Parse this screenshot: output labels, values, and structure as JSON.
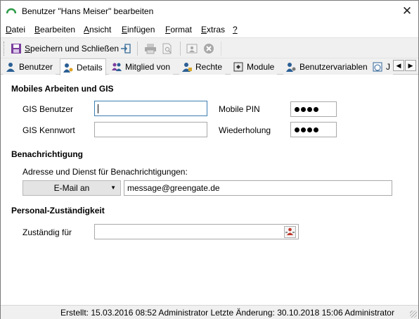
{
  "window": {
    "title": "Benutzer \"Hans Meiser\" bearbeiten",
    "close_glyph": "✕"
  },
  "menu": [
    {
      "accel": "D",
      "rest": "atei"
    },
    {
      "accel": "B",
      "rest": "earbeiten"
    },
    {
      "accel": "A",
      "rest": "nsicht"
    },
    {
      "accel": "E",
      "rest": "infügen"
    },
    {
      "accel": "F",
      "rest": "ormat"
    },
    {
      "accel": "E",
      "rest": "xtras"
    },
    {
      "accel": "?",
      "rest": ""
    }
  ],
  "toolbar": {
    "save_accel": "S",
    "save_rest": "peichern und Schließen"
  },
  "tabs": [
    {
      "label": "Benutzer"
    },
    {
      "label": "Details"
    },
    {
      "label": "Mitglied von"
    },
    {
      "label": "Rechte"
    },
    {
      "label": "Module"
    },
    {
      "label": "Benutzervariablen"
    },
    {
      "label": "J"
    }
  ],
  "tab_scroll": {
    "left": "◀",
    "right": "▶"
  },
  "mobile": {
    "heading": "Mobiles Arbeiten und GIS",
    "gis_user_label": "GIS Benutzer",
    "gis_user_value": "",
    "gis_pw_label": "GIS Kennwort",
    "gis_pw_value": "",
    "pin_label": "Mobile PIN",
    "repeat_label": "Wiederholung"
  },
  "notify": {
    "heading": "Benachrichtigung",
    "desc": "Adresse und Dienst für Benachrichtigungen:",
    "service": "E-Mail an",
    "service_arrow": "▼",
    "address": "message@greengate.de"
  },
  "responsibility": {
    "heading": "Personal-Zuständigkeit",
    "label": "Zuständig für",
    "value": ""
  },
  "status": {
    "text": "Erstellt: 15.03.2016 08:52 Administrator  Letzte Änderung: 30.10.2018 15:06 Administrator"
  },
  "colors": {
    "accent": "#3c7fb1",
    "app_icon_green": "#2e9b48",
    "save_icon": "#7a3e9d"
  }
}
